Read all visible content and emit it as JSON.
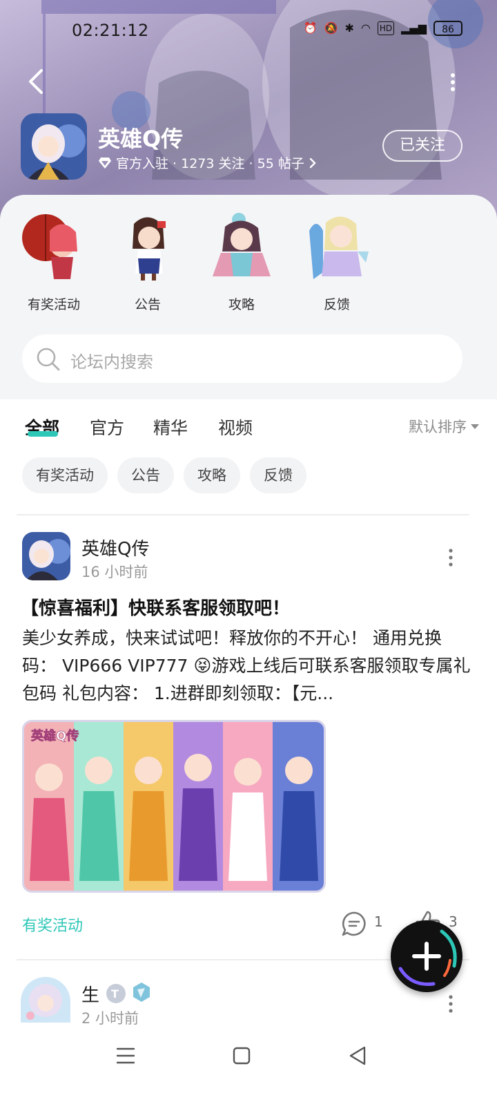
{
  "status_bar": {
    "time": "02:21:12",
    "battery": "86",
    "icons": [
      "alarm-icon",
      "mute-icon",
      "bluetooth-icon",
      "wifi-icon",
      "hd-icon",
      "signal-5g-icon",
      "battery-icon"
    ]
  },
  "header": {
    "title": "英雄Q传",
    "meta": "官方入驻 · 1273 关注 · 55 帖子",
    "follow_label": "已关注"
  },
  "categories": [
    {
      "label": "有奖活动",
      "icon": "reward-activity-icon"
    },
    {
      "label": "公告",
      "icon": "announcement-icon"
    },
    {
      "label": "攻略",
      "icon": "guide-icon"
    },
    {
      "label": "反馈",
      "icon": "feedback-icon"
    }
  ],
  "search": {
    "placeholder": "论坛内搜索"
  },
  "tabs": [
    {
      "label": "全部",
      "active": true
    },
    {
      "label": "官方",
      "active": false
    },
    {
      "label": "精华",
      "active": false
    },
    {
      "label": "视频",
      "active": false
    }
  ],
  "sort_label": "默认排序",
  "chips": [
    "有奖活动",
    "公告",
    "攻略",
    "反馈"
  ],
  "posts": [
    {
      "author": "英雄Q传",
      "time": "16 小时前",
      "title": "【惊喜福利】快联系客服领取吧！",
      "body": "美少女养成，快来试试吧！释放你的不开心！ 通用兑换码： VIP666 VIP777 😝游戏上线后可联系客服领取专属礼包码 礼包内容： 1.进群即刻领取：【元...",
      "image_caption": "英雄Q传",
      "tag": "有奖活动",
      "comments": "1",
      "likes": "3"
    },
    {
      "author": "生",
      "time": "2 小时前"
    }
  ],
  "colors": {
    "accent": "#2dc7b8",
    "header_bg": "#9c8fb8",
    "card_bg": "#f4f5f7"
  }
}
